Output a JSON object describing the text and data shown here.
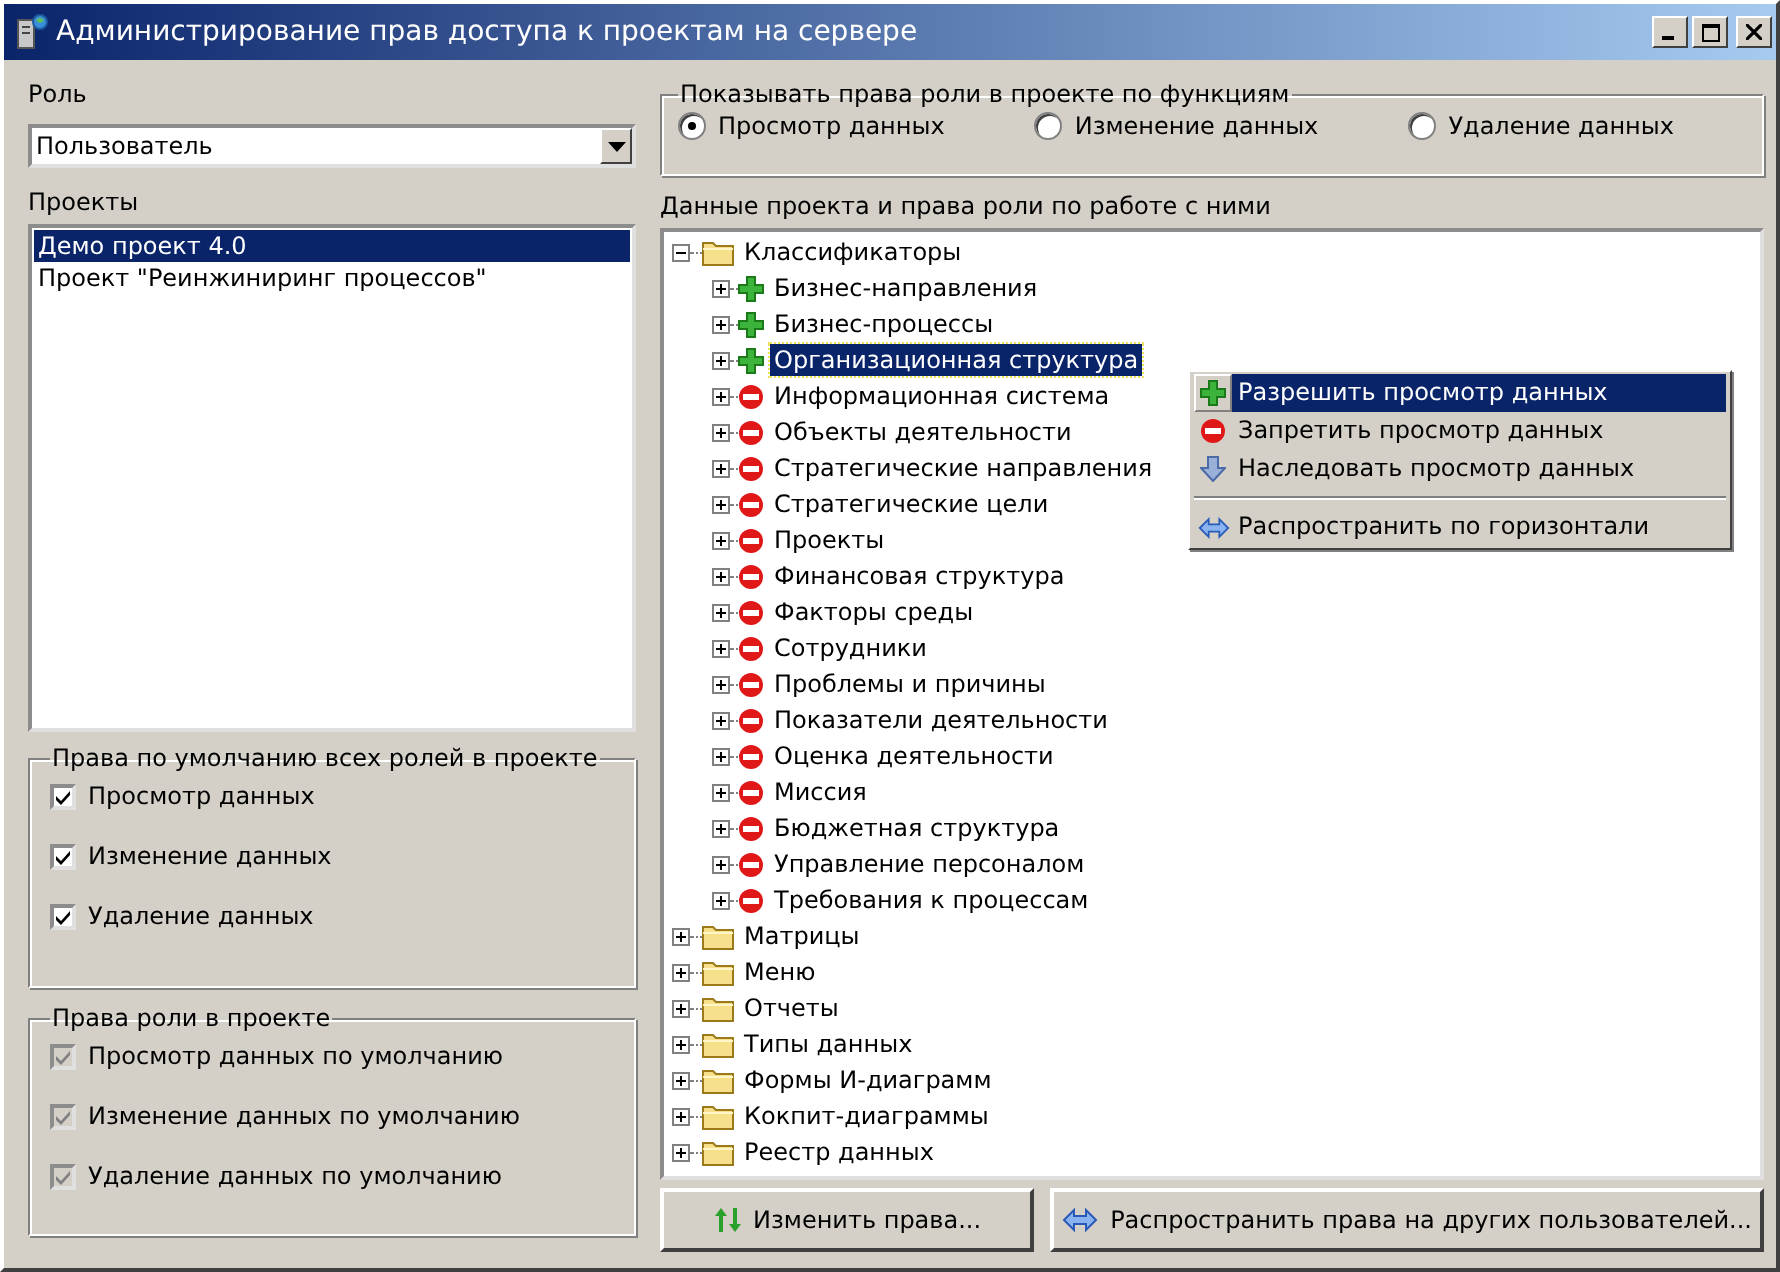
{
  "window": {
    "title": "Администрирование прав доступа к проектам на сервере"
  },
  "role": {
    "label": "Роль",
    "value": "Пользователь"
  },
  "projects": {
    "label": "Проекты",
    "items": [
      {
        "label": "Демо проект 4.0",
        "selected": true
      },
      {
        "label": "Проект \"Реинжиниринг процессов\"",
        "selected": false
      }
    ]
  },
  "default_rights": {
    "title": "Права по умолчанию всех ролей в проекте",
    "items": [
      {
        "label": "Просмотр данных",
        "checked": true,
        "disabled": false
      },
      {
        "label": "Изменение данных",
        "checked": true,
        "disabled": false
      },
      {
        "label": "Удаление данных",
        "checked": true,
        "disabled": false
      }
    ]
  },
  "role_rights": {
    "title": "Права роли в проекте",
    "items": [
      {
        "label": "Просмотр данных по умолчанию",
        "checked": true,
        "disabled": true
      },
      {
        "label": "Изменение данных по умолчанию",
        "checked": true,
        "disabled": true
      },
      {
        "label": "Удаление данных по умолчанию",
        "checked": true,
        "disabled": true
      }
    ]
  },
  "functions": {
    "title": "Показывать права роли в проекте по функциям",
    "options": [
      {
        "label": "Просмотр данных",
        "selected": true
      },
      {
        "label": "Изменение данных",
        "selected": false
      },
      {
        "label": "Удаление данных",
        "selected": false
      }
    ]
  },
  "tree": {
    "label": "Данные проекта и права роли по работе с ними",
    "items": [
      {
        "label": "Классификаторы",
        "kind": "folder",
        "expanded": true,
        "selected": false,
        "children": [
          {
            "label": "Бизнес-направления",
            "kind": "allow",
            "expanded": false,
            "selected": false
          },
          {
            "label": "Бизнес-процессы",
            "kind": "allow",
            "expanded": false,
            "selected": false
          },
          {
            "label": "Организационная структура",
            "kind": "allow",
            "expanded": false,
            "selected": true
          },
          {
            "label": "Информационная система",
            "kind": "deny",
            "expanded": false,
            "selected": false
          },
          {
            "label": "Объекты деятельности",
            "kind": "deny",
            "expanded": false,
            "selected": false
          },
          {
            "label": "Стратегические направления",
            "kind": "deny",
            "expanded": false,
            "selected": false
          },
          {
            "label": "Стратегические цели",
            "kind": "deny",
            "expanded": false,
            "selected": false
          },
          {
            "label": "Проекты",
            "kind": "deny",
            "expanded": false,
            "selected": false
          },
          {
            "label": "Финансовая структура",
            "kind": "deny",
            "expanded": false,
            "selected": false
          },
          {
            "label": "Факторы среды",
            "kind": "deny",
            "expanded": false,
            "selected": false
          },
          {
            "label": "Сотрудники",
            "kind": "deny",
            "expanded": false,
            "selected": false
          },
          {
            "label": "Проблемы и причины",
            "kind": "deny",
            "expanded": false,
            "selected": false
          },
          {
            "label": "Показатели деятельности",
            "kind": "deny",
            "expanded": false,
            "selected": false
          },
          {
            "label": "Оценка деятельности",
            "kind": "deny",
            "expanded": false,
            "selected": false
          },
          {
            "label": "Миссия",
            "kind": "deny",
            "expanded": false,
            "selected": false
          },
          {
            "label": "Бюджетная структура",
            "kind": "deny",
            "expanded": false,
            "selected": false
          },
          {
            "label": "Управление персоналом",
            "kind": "deny",
            "expanded": false,
            "selected": false
          },
          {
            "label": "Требования к процессам",
            "kind": "deny",
            "expanded": false,
            "selected": false
          }
        ]
      },
      {
        "label": "Матрицы",
        "kind": "folder",
        "expanded": false,
        "selected": false
      },
      {
        "label": "Меню",
        "kind": "folder",
        "expanded": false,
        "selected": false
      },
      {
        "label": "Отчеты",
        "kind": "folder",
        "expanded": false,
        "selected": false
      },
      {
        "label": "Типы данных",
        "kind": "folder",
        "expanded": false,
        "selected": false
      },
      {
        "label": "Формы И-диаграмм",
        "kind": "folder",
        "expanded": false,
        "selected": false
      },
      {
        "label": "Кокпит-диаграммы",
        "kind": "folder",
        "expanded": false,
        "selected": false
      },
      {
        "label": "Реестр данных",
        "kind": "folder",
        "expanded": false,
        "selected": false
      }
    ]
  },
  "context_menu": {
    "items": [
      {
        "kind": "allow",
        "label": "Разрешить просмотр данных",
        "selected": true
      },
      {
        "kind": "deny",
        "label": "Запретить просмотр данных",
        "selected": false
      },
      {
        "kind": "inherit",
        "label": "Наследовать просмотр данных",
        "selected": false
      },
      {
        "kind": "separator"
      },
      {
        "kind": "spread",
        "label": "Распространить по горизонтали",
        "selected": false
      }
    ]
  },
  "buttons": [
    {
      "kind": "change",
      "label": "Изменить права..."
    },
    {
      "kind": "spread",
      "label": "Распространить права на других пользователей..."
    }
  ]
}
